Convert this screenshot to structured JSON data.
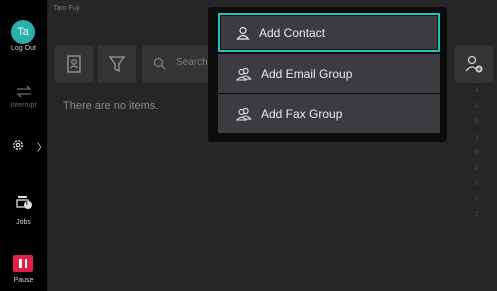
{
  "user": {
    "initials": "Ta",
    "name": "Taro Fuji"
  },
  "rail": {
    "logout_label": "Log Out",
    "interrupt_label": "Interrupt",
    "jobs_label": "Jobs",
    "pause_label": "Pause",
    "settings_chevron": "〉",
    "jobs_badge": "i"
  },
  "toolbar": {
    "search_placeholder": "Search",
    "address_book_icon": "address-book-icon",
    "filter_icon": "filter-icon",
    "add_icon": "add-contact-icon"
  },
  "list": {
    "empty_message": "There are no items."
  },
  "index": [
    "A",
    "D",
    "G",
    "J",
    "M",
    "P",
    "S",
    "V",
    "Z"
  ],
  "dropdown": {
    "items": [
      {
        "label": "Add Contact",
        "icon": "person-icon",
        "selected": true
      },
      {
        "label": "Add Email Group",
        "icon": "group-icon",
        "selected": false
      },
      {
        "label": "Add Fax Group",
        "icon": "group-icon",
        "selected": false
      }
    ]
  },
  "colors": {
    "accent": "#20c3b8",
    "avatar": "#27b1a9",
    "pause": "#e0204a",
    "panel": "#262628",
    "menu_item": "#3c3c40"
  }
}
